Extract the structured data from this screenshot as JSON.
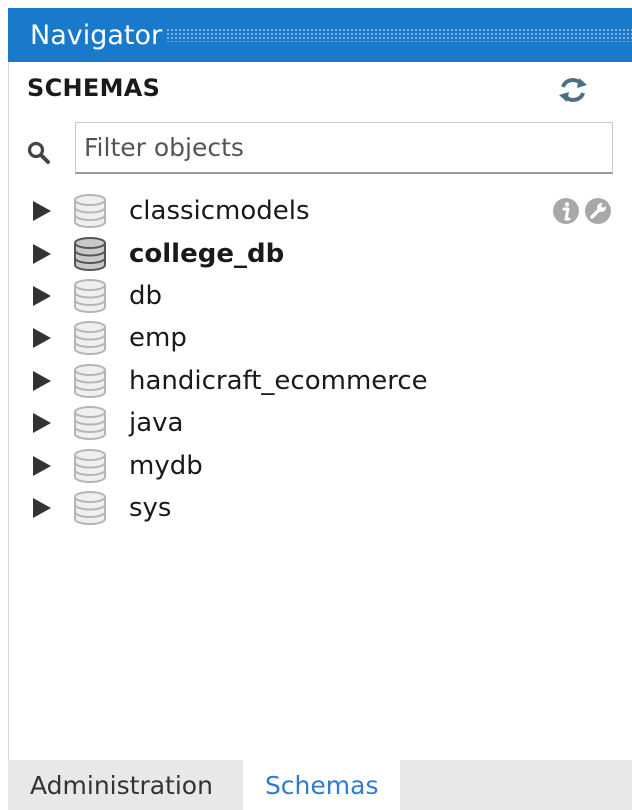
{
  "titlebar": {
    "title": "Navigator"
  },
  "schemas_panel": {
    "title": "SCHEMAS",
    "filter": {
      "placeholder": "Filter objects",
      "value": ""
    },
    "items": [
      {
        "label": "classicmodels",
        "bold": false,
        "hover": true
      },
      {
        "label": "college_db",
        "bold": true,
        "hover": false
      },
      {
        "label": "db",
        "bold": false,
        "hover": false
      },
      {
        "label": "emp",
        "bold": false,
        "hover": false
      },
      {
        "label": "handicraft_ecommerce",
        "bold": false,
        "hover": false
      },
      {
        "label": "java",
        "bold": false,
        "hover": false
      },
      {
        "label": "mydb",
        "bold": false,
        "hover": false
      },
      {
        "label": "sys",
        "bold": false,
        "hover": false
      }
    ]
  },
  "tabs": [
    {
      "label": "Administration",
      "active": false
    },
    {
      "label": "Schemas",
      "active": true
    }
  ],
  "colors": {
    "titlebar": "#1979ca",
    "active_tab_text": "#2f7bd0",
    "tab_strip": "#e8e8e8"
  }
}
